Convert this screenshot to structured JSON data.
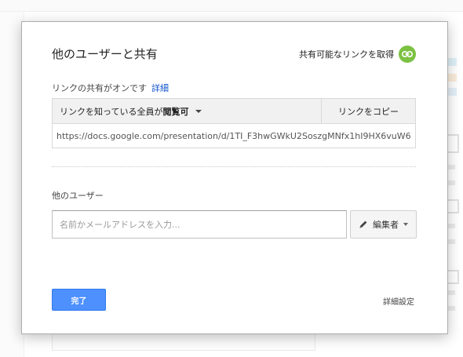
{
  "dialog": {
    "title": "他のユーザーと共有",
    "get_link_label": "共有可能なリンクを取得",
    "link_sharing_status": "リンクの共有がオンです",
    "details_link": "詳細",
    "access_prefix": "リンクを知っている全員が",
    "access_level": "閲覧可",
    "copy_link_label": "リンクをコピー",
    "share_url": "https://docs.google.com/presentation/d/1TI_F3hwGWkU2SoszgMNfx1hI9HX6vuW6",
    "other_users_label": "他のユーザー",
    "invite_placeholder": "名前かメールアドレスを入力...",
    "role_label": "編集者",
    "done_label": "完了",
    "advanced_label": "詳細設定"
  },
  "colors": {
    "accent_blue": "#4d90fe",
    "link_green": "#7cc142",
    "link_text_blue": "#1155cc"
  },
  "icons": {
    "get_link": "link-icon",
    "role": "pencil-icon",
    "access_dropdown": "caret-down-icon",
    "role_dropdown": "caret-down-icon"
  }
}
